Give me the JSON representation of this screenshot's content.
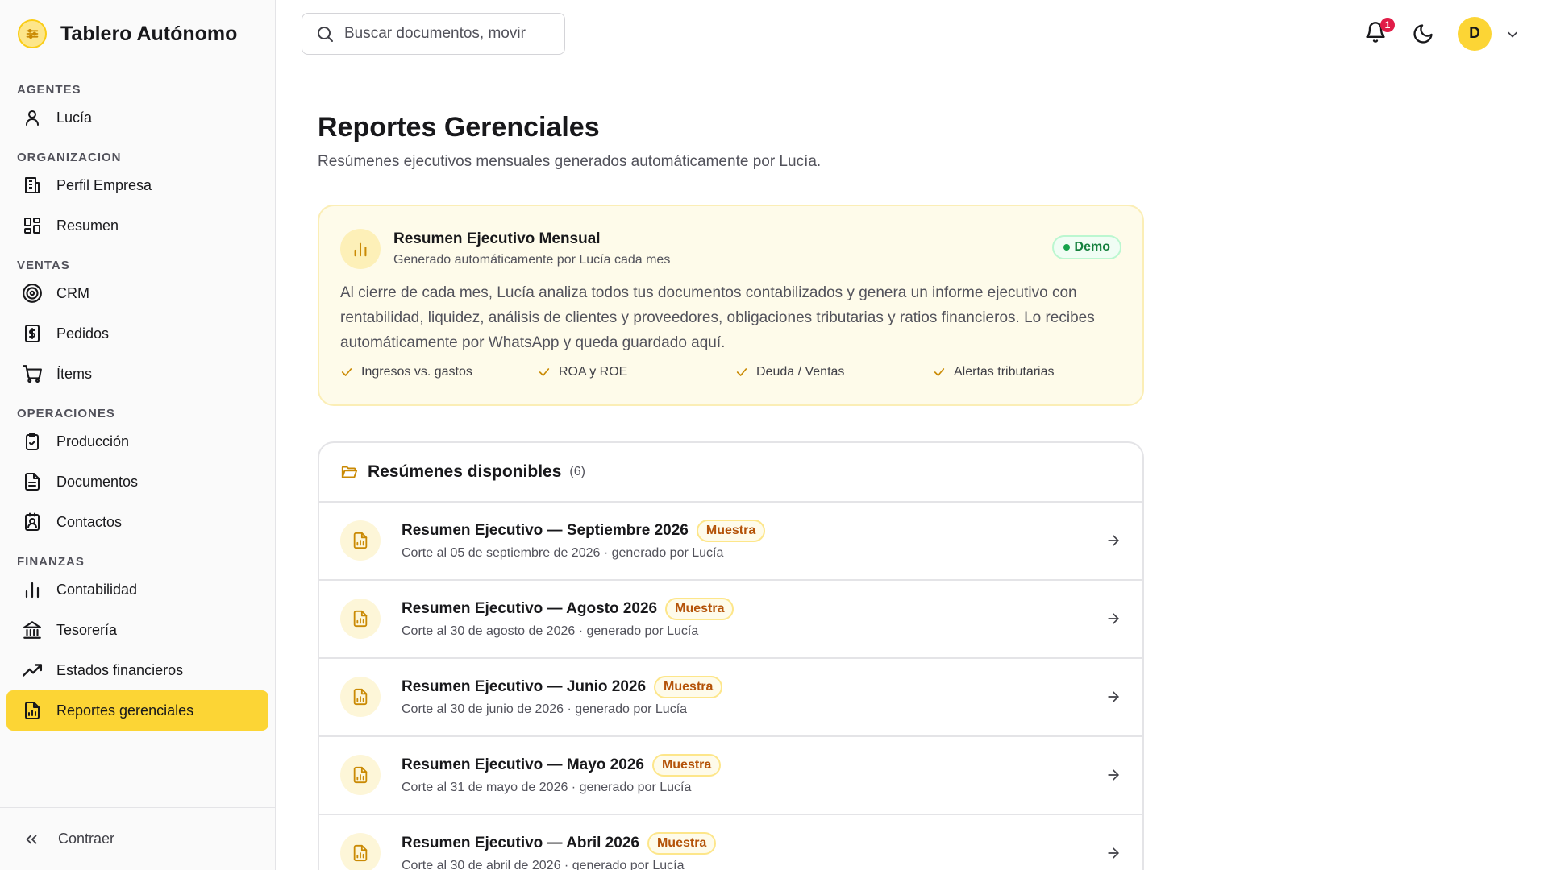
{
  "app": {
    "title": "Tablero Autónomo"
  },
  "search": {
    "placeholder": "Buscar documentos, movir"
  },
  "header": {
    "notifications_count": "1",
    "avatar_initial": "D"
  },
  "sidebar": {
    "sections": [
      {
        "label": "AGENTES",
        "items": [
          {
            "label": "Lucía",
            "icon": "user-icon"
          }
        ]
      },
      {
        "label": "ORGANIZACION",
        "items": [
          {
            "label": "Perfil Empresa",
            "icon": "building-icon"
          },
          {
            "label": "Resumen",
            "icon": "dashboard-icon"
          }
        ]
      },
      {
        "label": "VENTAS",
        "items": [
          {
            "label": "CRM",
            "icon": "target-icon"
          },
          {
            "label": "Pedidos",
            "icon": "receipt-dollar-icon"
          },
          {
            "label": "Ítems",
            "icon": "cart-icon"
          }
        ]
      },
      {
        "label": "OPERACIONES",
        "items": [
          {
            "label": "Producción",
            "icon": "clipboard-icon"
          },
          {
            "label": "Documentos",
            "icon": "document-icon"
          },
          {
            "label": "Contactos",
            "icon": "contact-icon"
          }
        ]
      },
      {
        "label": "FINANZAS",
        "items": [
          {
            "label": "Contabilidad",
            "icon": "bar-chart-icon"
          },
          {
            "label": "Tesorería",
            "icon": "bank-icon"
          },
          {
            "label": "Estados financieros",
            "icon": "trending-up-icon"
          },
          {
            "label": "Reportes gerenciales",
            "icon": "report-icon",
            "active": true
          }
        ]
      }
    ],
    "collapse_label": "Contraer"
  },
  "main": {
    "title": "Reportes Gerenciales",
    "subtitle": "Resúmenes ejecutivos mensuales generados automáticamente por Lucía.",
    "info_card": {
      "title": "Resumen Ejecutivo Mensual",
      "subtitle": "Generado automáticamente por Lucía cada mes",
      "badge": "Demo",
      "body": "Al cierre de cada mes, Lucía analiza todos tus documentos contabilizados y genera un informe ejecutivo con rentabilidad, liquidez, análisis de clientes y proveedores, obligaciones tributarias y ratios financieros. Lo recibes automáticamente por WhatsApp y queda guardado aquí.",
      "features": [
        "Ingresos vs. gastos",
        "ROA y ROE",
        "Deuda / Ventas",
        "Alertas tributarias"
      ]
    },
    "list": {
      "title": "Resúmenes disponibles",
      "count": "(6)",
      "rows": [
        {
          "title": "Resumen Ejecutivo — Septiembre 2026",
          "badge": "Muestra",
          "subtitle": "Corte al 05 de septiembre de 2026 · generado por Lucía"
        },
        {
          "title": "Resumen Ejecutivo — Agosto 2026",
          "badge": "Muestra",
          "subtitle": "Corte al 30 de agosto de 2026 · generado por Lucía"
        },
        {
          "title": "Resumen Ejecutivo — Junio 2026",
          "badge": "Muestra",
          "subtitle": "Corte al 30 de junio de 2026 · generado por Lucía"
        },
        {
          "title": "Resumen Ejecutivo — Mayo 2026",
          "badge": "Muestra",
          "subtitle": "Corte al 31 de mayo de 2026 · generado por Lucía"
        },
        {
          "title": "Resumen Ejecutivo — Abril 2026",
          "badge": "Muestra",
          "subtitle": "Corte al 30 de abril de 2026 · generado por Lucía"
        }
      ]
    }
  },
  "colors": {
    "accent": "#fcd535",
    "accent_soft": "#fefbea",
    "success": "#16a34a",
    "badge_text": "#b45309",
    "notification": "#e11d48"
  }
}
